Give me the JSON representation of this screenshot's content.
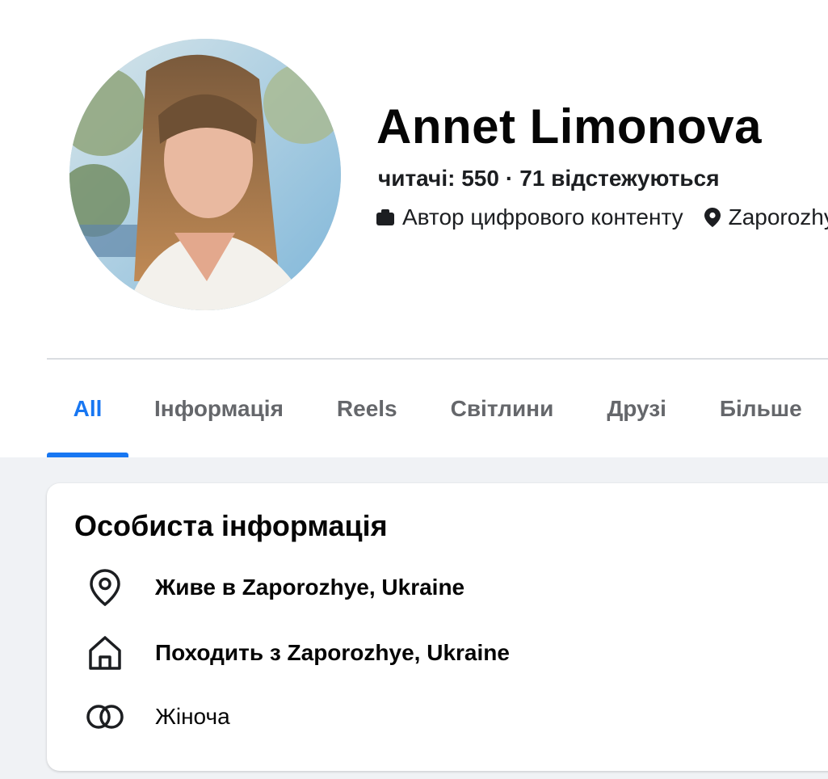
{
  "profile": {
    "name": "Annet Limonova",
    "followers": "читачі: 550",
    "separator": "·",
    "following": "71 відстежуються",
    "category": "Автор цифрового контенту",
    "location_short": "Zaporozhye"
  },
  "tabs": [
    {
      "label": "All",
      "active": true
    },
    {
      "label": "Інформація"
    },
    {
      "label": "Reels"
    },
    {
      "label": "Світлини"
    },
    {
      "label": "Друзі"
    },
    {
      "label": "Більше"
    }
  ],
  "info_card": {
    "title": "Особиста інформація",
    "rows": [
      {
        "icon": "location-pin-icon",
        "text": "Живе в Zaporozhye, Ukraine"
      },
      {
        "icon": "home-icon",
        "text": "Походить з Zaporozhye, Ukraine"
      },
      {
        "icon": "gender-rings-icon",
        "text": "Жіноча"
      }
    ]
  },
  "colors": {
    "accent": "#1877f2",
    "tab_inactive": "#65676b",
    "page_bg": "#f0f2f5"
  }
}
